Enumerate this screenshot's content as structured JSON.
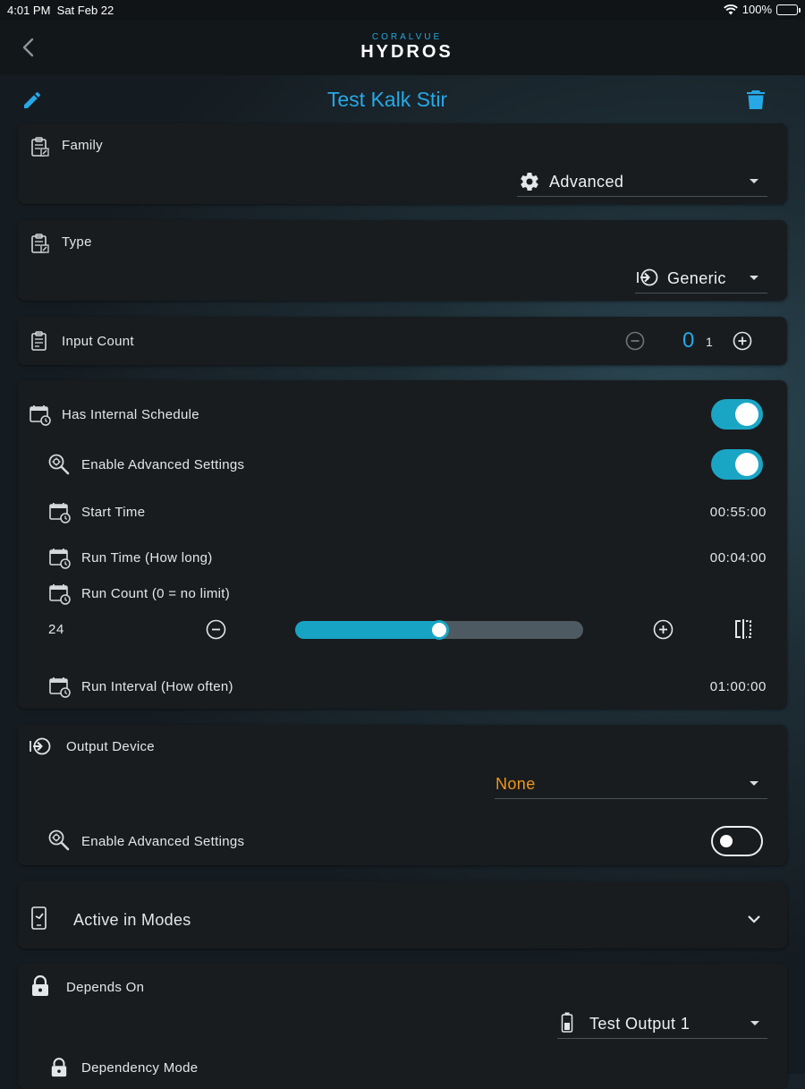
{
  "status_bar": {
    "time": "4:01 PM",
    "date": "Sat Feb 22",
    "battery": "100%"
  },
  "header": {
    "logo_small": "CORALVUE",
    "logo_big": "HYDROS"
  },
  "page": {
    "title": "Test Kalk Stir"
  },
  "family": {
    "label": "Family",
    "value": "Advanced"
  },
  "type": {
    "label": "Type",
    "value": "Generic"
  },
  "input_count": {
    "label": "Input Count",
    "value": "0",
    "max": "1"
  },
  "schedule": {
    "has_label": "Has Internal Schedule",
    "has_on": true,
    "advanced_label": "Enable Advanced Settings",
    "advanced_on": true,
    "start_label": "Start Time",
    "start_value": "00:55:00",
    "run_time_label": "Run Time (How long)",
    "run_time_value": "00:04:00",
    "run_count_label": "Run Count (0 = no limit)",
    "run_count_value": "24",
    "run_count_fill_percent": 50,
    "interval_label": "Run Interval (How often)",
    "interval_value": "01:00:00"
  },
  "output_device": {
    "label": "Output Device",
    "value": "None",
    "value_color": "#f0961c",
    "advanced_label": "Enable  Advanced Settings",
    "advanced_on": false
  },
  "modes": {
    "label": "Active in Modes"
  },
  "depends": {
    "label": "Depends On",
    "value": "Test Output 1",
    "mode_label": "Dependency Mode"
  },
  "colors": {
    "accent": "#27a8e6",
    "toggle_on": "#1aa5c4"
  }
}
